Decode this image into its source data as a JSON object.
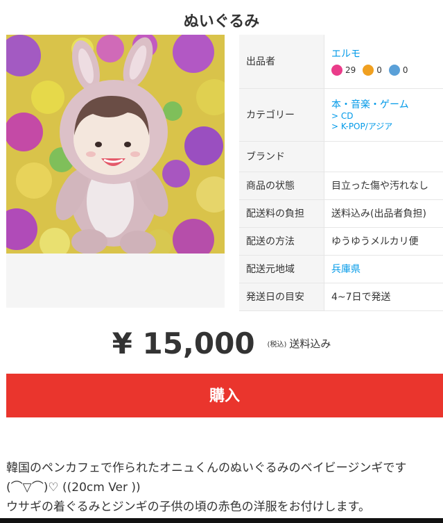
{
  "item": {
    "title": "ぬいぐるみ",
    "image_alt": "ウサギの着ぐるみを着たぬいぐるみ"
  },
  "details": {
    "seller_label": "出品者",
    "seller_name": "エルモ",
    "rating_good": "29",
    "rating_normal": "0",
    "rating_bad": "0",
    "category_label": "カテゴリー",
    "category_main": "本・音楽・ゲーム",
    "category_sub1": "CD",
    "category_sub2": "K-POP/アジア",
    "brand_label": "ブランド",
    "brand_value": "",
    "condition_label": "商品の状態",
    "condition_value": "目立った傷や汚れなし",
    "shipping_fee_label": "配送料の負担",
    "shipping_fee_value": "送料込み(出品者負担)",
    "shipping_method_label": "配送の方法",
    "shipping_method_value": "ゆうゆうメルカリ便",
    "ship_from_label": "配送元地域",
    "ship_from_value": "兵庫県",
    "ship_days_label": "発送日の目安",
    "ship_days_value": "4~7日で発送"
  },
  "price": {
    "amount": "¥ 15,000",
    "tax": "(税込)",
    "shipping": "送料込み"
  },
  "buy_button": {
    "label": "購入"
  },
  "description": {
    "line1": "韓国のペンカフェで作られたオニュくんのぬいぐるみのベイビージンギです",
    "line2": "(⌒▽⌒)♡ ((20cm Ver ))",
    "line3": "ウサギの着ぐるみとジンギの子供の頃の赤色の洋服をお付けします。"
  },
  "colors": {
    "accent_red": "#ea352d",
    "link_blue": "#0099e8",
    "good": "#ea3c8a",
    "normal": "#f0a020",
    "bad": "#5aa0d8"
  }
}
